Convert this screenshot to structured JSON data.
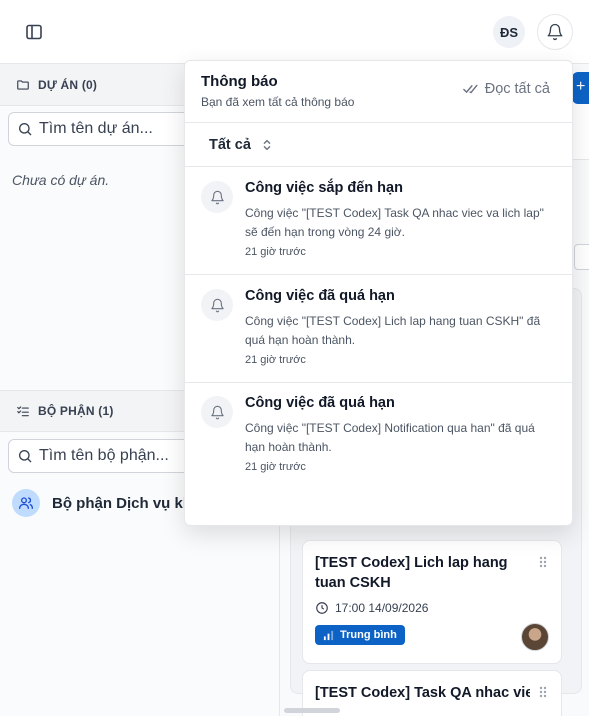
{
  "header": {
    "user_initials": "ĐS"
  },
  "sidebar": {
    "projects_heading": "DỰ ÁN (0)",
    "projects_search_placeholder": "Tìm tên dự án...",
    "projects_empty": "Chưa có dự án.",
    "departments_heading": "BỘ PHẬN (1)",
    "departments_search_placeholder": "Tìm tên bộ phận...",
    "departments": [
      {
        "label": "Bộ phận Dịch vụ khách hàng"
      }
    ]
  },
  "board": {
    "new_button": "+",
    "cards": [
      {
        "title": "[TEST Codex] Lich lap hang tuan CSKH",
        "date": "17:00 14/09/2026",
        "priority": "Trung bình"
      },
      {
        "title": "[TEST Codex] Task QA nhac viec"
      }
    ]
  },
  "notifications": {
    "title": "Thông báo",
    "subtitle": "Bạn đã xem tất cả thông báo",
    "read_all": "Đọc tất cả",
    "filter_value": "Tất cả",
    "items": [
      {
        "title": "Công việc sắp đến hạn",
        "body": "Công việc \"[TEST Codex] Task QA nhac viec va lich lap\" sẽ đến hạn trong vòng 24 giờ.",
        "time": "21 giờ trước"
      },
      {
        "title": "Công việc đã quá hạn",
        "body": "Công việc \"[TEST Codex] Lich lap hang tuan CSKH\" đã quá hạn hoàn thành.",
        "time": "21 giờ trước"
      },
      {
        "title": "Công việc đã quá hạn",
        "body": "Công việc \"[TEST Codex] Notification qua han\" đã quá hạn hoàn thành.",
        "time": "21 giờ trước"
      }
    ]
  },
  "colors": {
    "accent": "#0d63c5",
    "dept_icon_bg": "#bfdbfe"
  }
}
